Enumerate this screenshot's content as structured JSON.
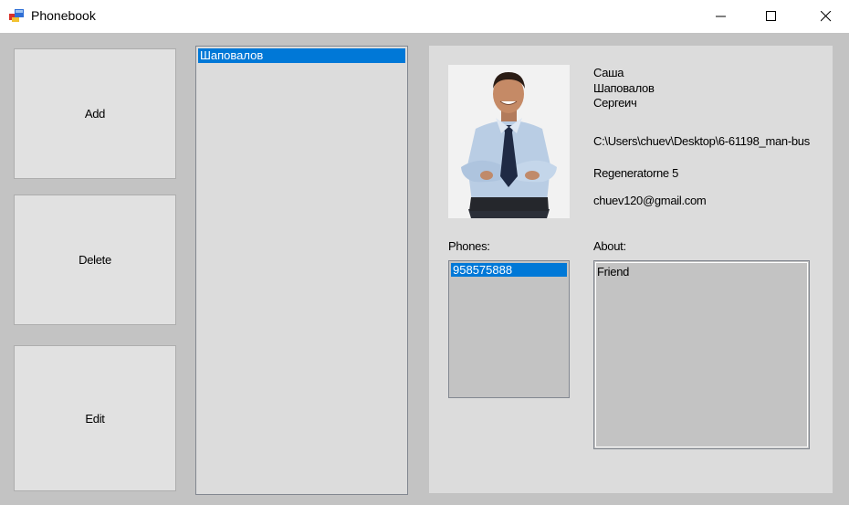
{
  "window": {
    "title": "Phonebook",
    "icons": {
      "app": "phonebook-app-icon",
      "minimize": "minimize-icon",
      "maximize": "maximize-icon",
      "close": "close-icon"
    }
  },
  "actions": {
    "add": "Add",
    "delete": "Delete",
    "edit": "Edit"
  },
  "contacts": {
    "items": [
      "Шаповалов"
    ],
    "selected": "Шаповалов"
  },
  "contact": {
    "first_name": "Саша",
    "last_name": "Шаповалов",
    "middle_name": "Сергеич",
    "photo_path": "C:\\Users\\chuev\\Desktop\\6-61198_man-bus",
    "address": "Regeneratorne 5",
    "email": "chuev120@gmail.com",
    "phones_label": "Phones:",
    "phones": [
      "958575888"
    ],
    "about_label": "About:",
    "about": "Friend"
  },
  "colors": {
    "selection": "#0078d7",
    "background": "#c3c3c3",
    "panel": "#dcdcdc"
  }
}
